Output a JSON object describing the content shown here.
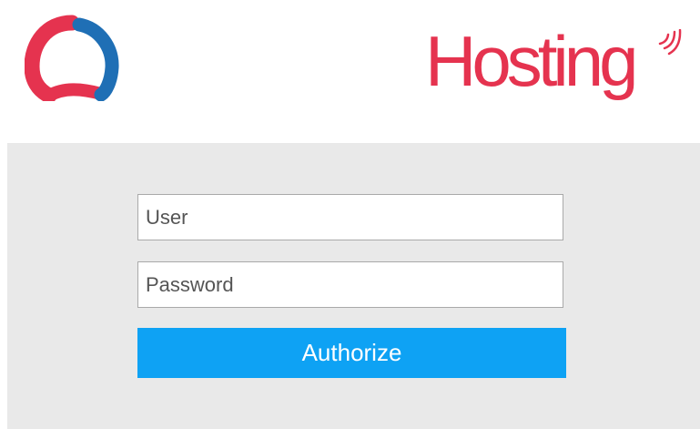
{
  "header": {
    "logo_icon": "ring-logo-icon",
    "brand_text": "Hosting",
    "brand_icon": "signal-waves-icon"
  },
  "login": {
    "user_placeholder": "User",
    "password_placeholder": "Password",
    "authorize_label": "Authorize"
  },
  "colors": {
    "brand_red": "#e5334f",
    "logo_blue": "#1f6fb5",
    "panel_background": "#e9e9e9",
    "button_blue": "#0ea2f4"
  }
}
